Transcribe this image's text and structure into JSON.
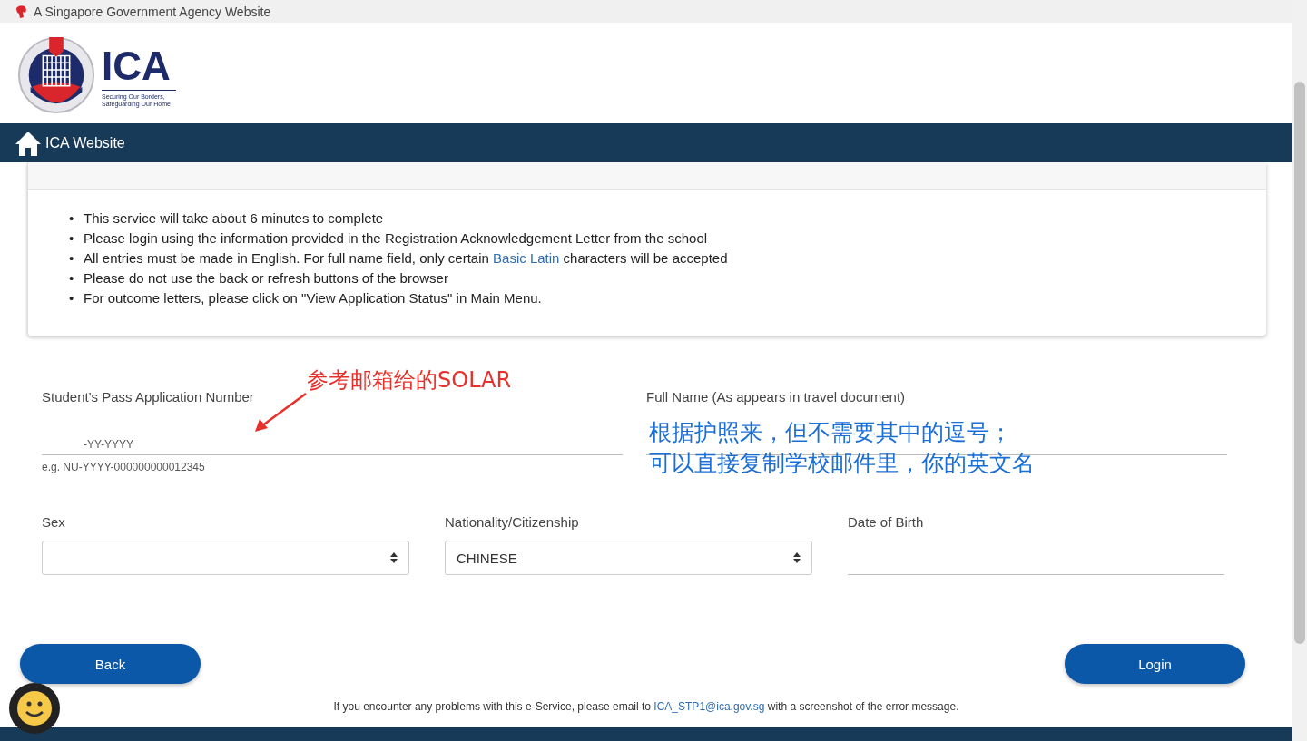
{
  "gov_bar": {
    "text": "A Singapore Government Agency Website"
  },
  "logo": {
    "name": "ICA",
    "tagline": [
      "Securing Our Borders,",
      "Safeguarding Our Home"
    ]
  },
  "nav": {
    "label": "ICA Website"
  },
  "notes": {
    "items": [
      {
        "marker": "•",
        "text": "This service will take about 6 minutes to complete"
      },
      {
        "marker": "•",
        "text": "Please login using the information provided in the Registration Acknowledgement Letter from the school"
      },
      {
        "marker": "•",
        "text": "All entries must be made in English. For full name field, only certain ",
        "link": "Basic Latin",
        "after": " characters will be accepted"
      },
      {
        "marker": "•",
        "text": "Please do not use the back or refresh buttons of the browser"
      },
      {
        "marker": "•",
        "text": "For outcome letters, please click on \"View Application Status\" in Main Menu."
      }
    ]
  },
  "fields_row_1": [
    {
      "kind": "text",
      "label": "Student's Pass Application Number",
      "value": "-YY-YYYY",
      "hint": "e.g. NU-YYYY-000000000012345"
    },
    {
      "kind": "text",
      "label": "Full Name (As appears in travel document)"
    }
  ],
  "fields_row_2": [
    {
      "kind": "select",
      "label": "Sex"
    },
    {
      "kind": "select",
      "label": "Nationality/Citizenship",
      "value": "CHINESE"
    },
    {
      "kind": "text",
      "label": "Date of Birth"
    }
  ],
  "buttons": [
    {
      "label": "Back"
    },
    {
      "label": "Login"
    }
  ],
  "footer": {
    "before": "If you encounter any problems with this e-Service, please email to ",
    "email": "ICA_STP1@ica.gov.sg",
    "after": " with a screenshot of the error message."
  },
  "annotations": [
    {
      "kind": "arrow",
      "text": "参考邮箱给的SOLAR",
      "color": "#e8302a"
    },
    {
      "kind": "note",
      "lines": [
        "根据护照来，但不需要其中的逗号；",
        "可以直接复制学校邮件里，你的英文名"
      ],
      "color": "#1a6fd6"
    }
  ]
}
